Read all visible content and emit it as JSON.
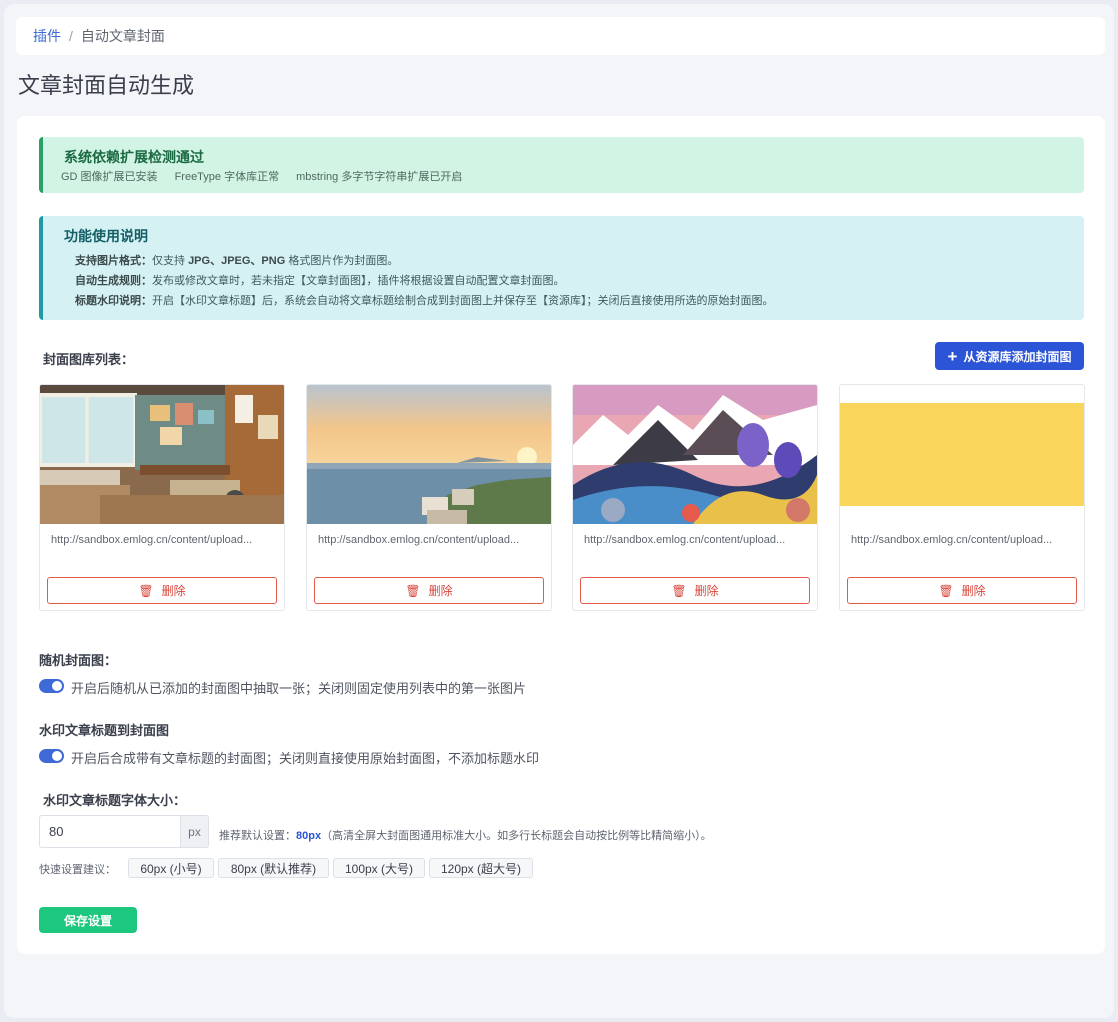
{
  "breadcrumb": {
    "parent": "插件",
    "separator": "/",
    "current": "自动文章封面"
  },
  "page_title": "文章封面自动生成",
  "deps_alert": {
    "title": "系统依赖扩展检测通过",
    "items": [
      "GD 图像扩展已安装",
      "FreeType 字体库正常",
      "mbstring 多字节字符串扩展已开启"
    ]
  },
  "info_alert": {
    "title": "功能使用说明",
    "lines": [
      {
        "label": "支持图片格式：",
        "text": "仅支持 ",
        "bold": "JPG、JPEG、PNG",
        "tail": " 格式图片作为封面图。"
      },
      {
        "label": "自动生成规则：",
        "text": "发布或修改文章时，若未指定【文章封面图】，插件将根据设置自动配置文章封面图。",
        "bold": "",
        "tail": ""
      },
      {
        "label": "标题水印说明：",
        "text": "开启【水印文章标题】后，系统会自动将文章标题绘制合成到封面图上并保存至【资源库】；关闭后直接使用所选的原始封面图。",
        "bold": "",
        "tail": ""
      }
    ]
  },
  "gallery": {
    "label": "封面图库列表：",
    "add_button": "从资源库添加封面图",
    "add_icon": "plus-icon",
    "items": [
      {
        "url": "http://sandbox.emlog.cn/content/upload...",
        "delete_label": "删除"
      },
      {
        "url": "http://sandbox.emlog.cn/content/upload...",
        "delete_label": "删除"
      },
      {
        "url": "http://sandbox.emlog.cn/content/upload...",
        "delete_label": "删除"
      },
      {
        "url": "http://sandbox.emlog.cn/content/upload...",
        "delete_label": "删除"
      }
    ]
  },
  "random_cover": {
    "label": "随机封面图：",
    "enabled": true,
    "description": "开启后随机从已添加的封面图中抽取一张；关闭则固定使用列表中的第一张图片"
  },
  "watermark": {
    "label": "水印文章标题到封面图",
    "enabled": true,
    "description": "开启后合成带有文章标题的封面图；关闭则直接使用原始封面图，不添加标题水印"
  },
  "font_size": {
    "label": "水印文章标题字体大小：",
    "value": "80",
    "unit": "px",
    "hint_prefix": "推荐默认设置：",
    "hint_value": "80px",
    "hint_suffix": "（高清全屏大封面图通用标准大小。如多行长标题会自动按比例等比精简缩小）。",
    "quick_label": "快速设置建议：",
    "presets": [
      "60px (小号)",
      "80px (默认推荐)",
      "100px (大号)",
      "120px (超大号)"
    ]
  },
  "save_button": "保存设置",
  "colors": {
    "primary": "#2b54d6",
    "success": "#1ec77e",
    "danger": "#d8463a"
  }
}
